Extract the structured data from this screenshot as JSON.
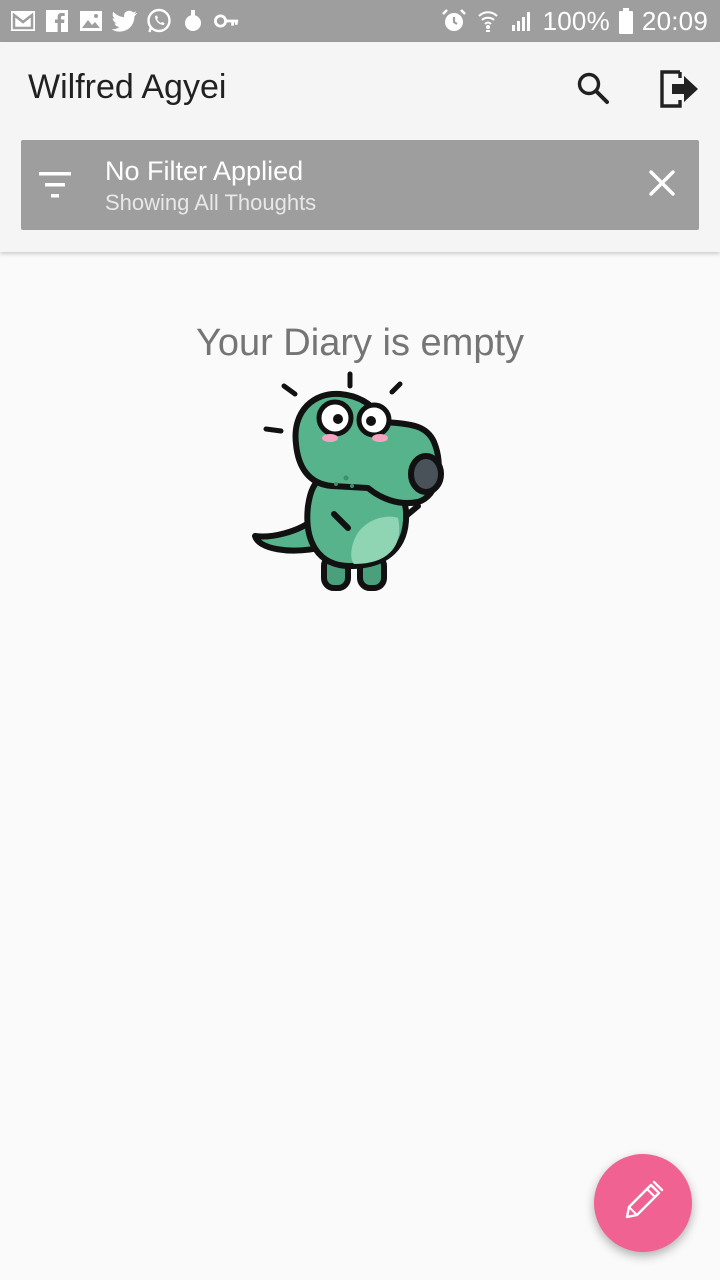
{
  "status_bar": {
    "battery_percent": "100%",
    "time": "20:09",
    "left_icons": [
      "gmail-icon",
      "facebook-icon",
      "image-icon",
      "twitter-icon",
      "whatsapp-icon",
      "bulb-icon",
      "key-icon"
    ],
    "right_icons": [
      "alarm-icon",
      "wifi-icon",
      "signal-icon",
      "battery-icon"
    ]
  },
  "toolbar": {
    "title": "Wilfred Agyei",
    "search_icon": "search-icon",
    "logout_icon": "logout-icon"
  },
  "filter": {
    "title": "No Filter Applied",
    "subtitle": "Showing All Thoughts",
    "filter_icon": "filter-list-icon",
    "clear_icon": "close-icon"
  },
  "empty_state": {
    "message": "Your Diary is empty",
    "illustration": "dinosaur-illustration"
  },
  "fab": {
    "icon": "pen-icon",
    "color": "#f06292"
  },
  "colors": {
    "status_bar": "#9e9e9e",
    "filter_card": "#9e9e9e",
    "accent": "#f06292",
    "dino_green": "#4caf8a"
  }
}
